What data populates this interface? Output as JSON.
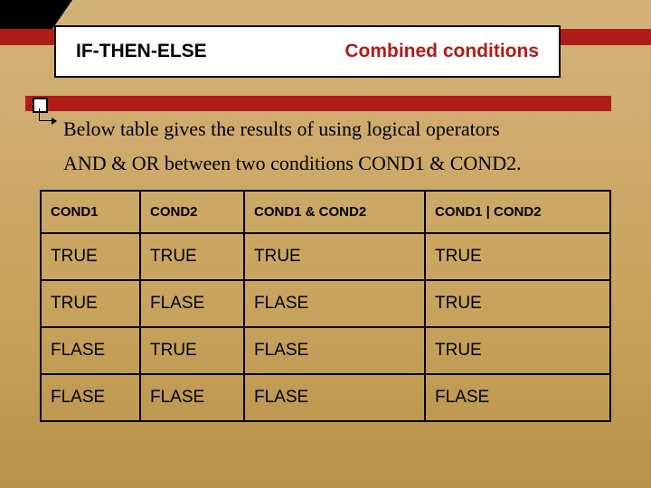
{
  "header": {
    "title_left": "IF-THEN-ELSE",
    "title_right": "Combined conditions"
  },
  "body": {
    "line1": "Below table gives the results of using logical operators",
    "line2": "AND & OR between two conditions COND1 & COND2."
  },
  "table": {
    "headers": [
      "COND1",
      "COND2",
      "COND1 & COND2",
      "COND1 | COND2"
    ],
    "rows": [
      [
        "TRUE",
        "TRUE",
        "TRUE",
        "TRUE"
      ],
      [
        "TRUE",
        "FLASE",
        "FLASE",
        "TRUE"
      ],
      [
        "FLASE",
        "TRUE",
        "FLASE",
        "TRUE"
      ],
      [
        "FLASE",
        "FLASE",
        "FLASE",
        "FLASE"
      ]
    ]
  }
}
